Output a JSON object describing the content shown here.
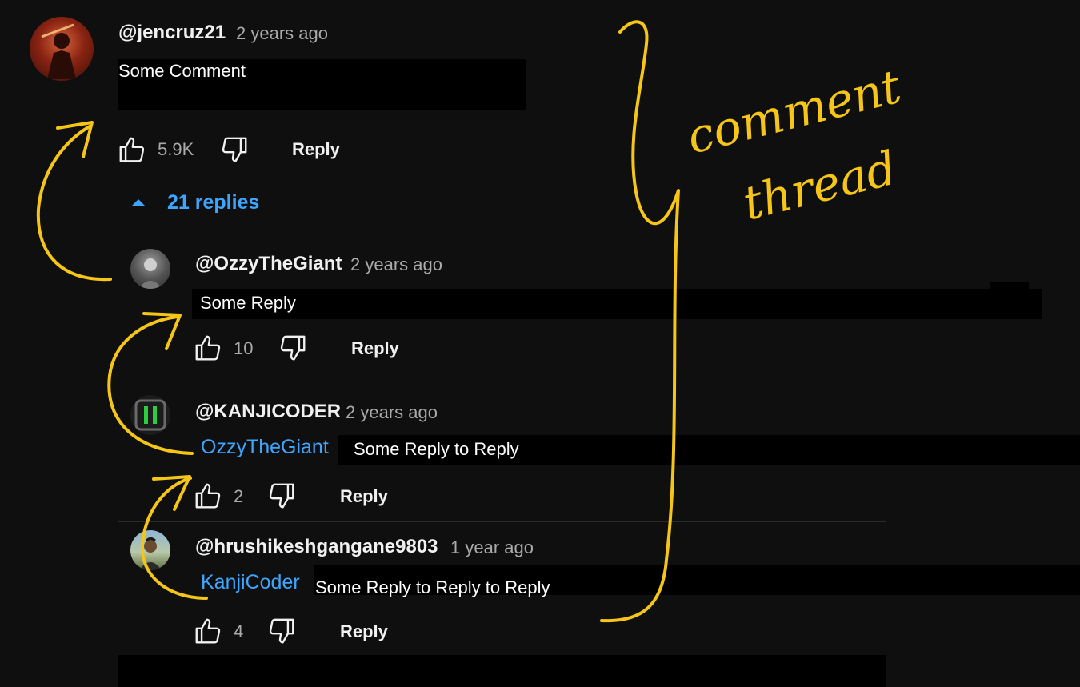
{
  "colors": {
    "background": "#0f0f0f",
    "link": "#3ea6ff",
    "annotation": "#f5c518",
    "muted": "#aaaaaa"
  },
  "comment": {
    "handle": "@jencruz21",
    "time": "2 years ago",
    "text": "Some Comment",
    "likes": "5.9K",
    "reply_label": "Reply",
    "replies_toggle": "21 replies"
  },
  "replies": [
    {
      "handle": "@OzzyTheGiant",
      "time": "2 years ago",
      "mention": "",
      "text": "Some Reply",
      "likes": "10",
      "reply_label": "Reply"
    },
    {
      "handle": "@KANJICODER",
      "time": "2 years ago",
      "mention": "OzzyTheGiant",
      "text": "Some Reply to Reply",
      "likes": "2",
      "reply_label": "Reply"
    },
    {
      "handle": "@hrushikeshgangane9803",
      "time": "1 year ago",
      "mention": "KanjiCoder",
      "text": "Some Reply to Reply to Reply",
      "likes": "4",
      "reply_label": "Reply"
    }
  ],
  "annotation": {
    "line1": "comment",
    "line2": "thread"
  },
  "icons": {
    "like": "thumbs-up-icon",
    "dislike": "thumbs-down-icon",
    "expand": "caret-up-icon"
  }
}
